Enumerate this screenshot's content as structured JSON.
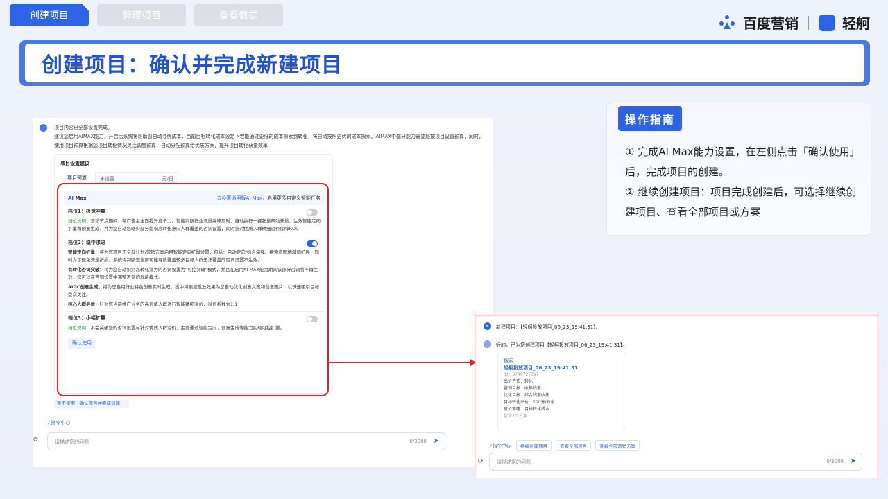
{
  "tabs": [
    {
      "label": "创建项目"
    },
    {
      "label": "管理项目"
    },
    {
      "label": "查看数据"
    }
  ],
  "brand": {
    "name1": "百度营销",
    "name2": "轻舸"
  },
  "title": "创建项目：确认并完成新建项目",
  "left_panel": {
    "msg_line1": "项目内容已全部设置完成。",
    "msg_line2": "建议您启用AIMAX能力，开启后系统将帮助您自动寻优成本，当前目标转化成本设定下若能通过更低的成本探索到转化，将自动按照更优的成本探索。AIMAX中部分能力需要您按项目设置预算，同时，使用项目预算根据您项目转化情况灵活调度预算，自动分配预算给优质方案，提升项目转化获量效率",
    "card_title": "项目设置建议",
    "budget_label": "项目预算",
    "budget_value": "未设置",
    "budget_unit": "元/日",
    "aimax_label": "Max",
    "aimax_link": "去设置通用版AI Max，",
    "aimax_link_suffix": "启用更多自定义智能任务",
    "slot1_title": "档位1：极速冲量",
    "slot1_desc_label": "档位说明：",
    "slot1_desc": "营销节点期间，帮广告主全面提升竞争力。智能判断行业流量高峰期时，自动执行一键起量帮助获量，生效智能定向扩量和创意生成，并为您自动忽略少部分影响高转化意向人群覆盖的否词设置，同时针对优质人群精细溢价保障ROI。",
    "slot2_title": "档位2：稳中求进",
    "slot2_p1_label": "智能定向扩量：",
    "slot2_p1": "将为您项目下全部计划/营销方案启用智能定向扩量设置，包括：自动定向/综合演绎、搜索意图地域词扩展，同时为了避免流量折损，系统将判断您当前可能导致覆盖较多目标人群无法覆盖的否词设置不生效。",
    "slot2_p2_label": "有转化否词突破：",
    "slot2_p2": "将为您自动识别高转化潜力的否词设置为\"可控突破\"模式，并且在启用AI MAX能力期间该部分否词将不再生效，您可以在否词设置中调整否词的屏蔽模式。",
    "slot2_p3_label": "AIGC创意生成：",
    "slot2_p3": "将为您启用行业特色创意实时生成，投中将根据投放效果为您自动优化创意文案和创意图片，以快速吸引目标受众关注。",
    "slot2_p4_label": "核心人群寻优：",
    "slot2_p4": "针对您当前推广业务的高价值人群进行智能精细溢价，溢价系数为1.1",
    "slot3_title": "档位3：小幅扩量",
    "slot3_desc_label": "档位说明：",
    "slot3_desc": "不会突破您的否词设置与针对优质人群溢价，主要通过智能定向、创意生成等能力实现可控扩量。",
    "confirm_btn": "确认使用",
    "not_use_btn": "暂不使用，确认项目并完成创建",
    "cmd_center": "指令中心",
    "input_placeholder": "请描述您的问题",
    "input_count": "0/3000"
  },
  "guide": {
    "title": "操作指南",
    "step1": "① 完成AI Max能力设置，在左侧点击「确认使用」后，完成项目的创建。",
    "step2": "② 继续创建项目：项目完成创建后，可选择继续创建项目、查看全部项目或方案"
  },
  "right_panel": {
    "user_avatar": "S",
    "user_msg": "新建项目：【轻舸投放项目_06_23_19:41:31】。",
    "bot_msg": "好的，已为您创建项目【轻舸投放项目_06_23_19:41:31】。",
    "card_kind": "搜索",
    "project_name": "轻舸投放项目_06_23_19:41:31",
    "project_id": "ID：3749727097",
    "bid_mode": "出价方式：转化",
    "goal": "营销目标：收集线索",
    "opt_goal": "优化目标：综合线索收集",
    "target_cost": "目标转化出价：100元/转化",
    "strategy": "竞价策略：目标转化成本",
    "plans": "包含2个方案",
    "cmd_center": "指令中心",
    "action1": "继续创建项目",
    "action2": "查看全部项目",
    "action3": "查看全部营销方案",
    "input_placeholder": "请描述您的问题",
    "input_count": "0/3000"
  },
  "colors": {
    "accent": "#2d64e6",
    "highlight": "#d9252e",
    "green": "#2aa043"
  }
}
